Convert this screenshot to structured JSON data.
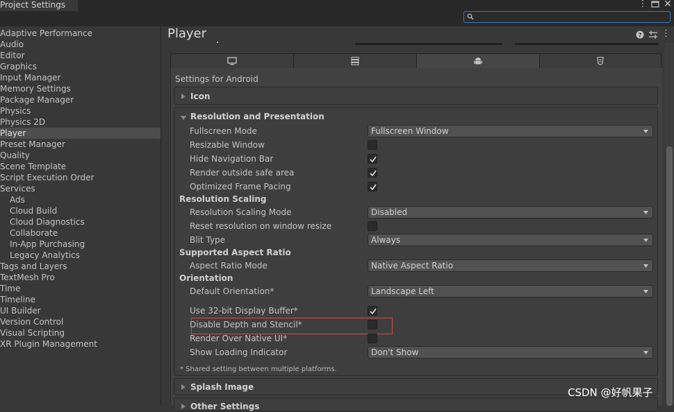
{
  "window": {
    "tab_title": "Project Settings",
    "menu_glyph": "⋮",
    "close_glyph": "✕",
    "more_glyph": "⋮"
  },
  "search": {
    "placeholder": ""
  },
  "sidebar": {
    "items": [
      {
        "label": "Adaptive Performance"
      },
      {
        "label": "Audio"
      },
      {
        "label": "Editor"
      },
      {
        "label": "Graphics"
      },
      {
        "label": "Input Manager"
      },
      {
        "label": "Memory Settings"
      },
      {
        "label": "Package Manager"
      },
      {
        "label": "Physics"
      },
      {
        "label": "Physics 2D"
      },
      {
        "label": "Player",
        "selected": true
      },
      {
        "label": "Preset Manager"
      },
      {
        "label": "Quality"
      },
      {
        "label": "Scene Template"
      },
      {
        "label": "Script Execution Order"
      },
      {
        "label": "Services"
      },
      {
        "label": "Ads",
        "sub": true
      },
      {
        "label": "Cloud Build",
        "sub": true
      },
      {
        "label": "Cloud Diagnostics",
        "sub": true
      },
      {
        "label": "Collaborate",
        "sub": true
      },
      {
        "label": "In-App Purchasing",
        "sub": true
      },
      {
        "label": "Legacy Analytics",
        "sub": true
      },
      {
        "label": "Tags and Layers"
      },
      {
        "label": "TextMesh Pro"
      },
      {
        "label": "Time"
      },
      {
        "label": "Timeline"
      },
      {
        "label": "UI Builder"
      },
      {
        "label": "Version Control"
      },
      {
        "label": "Visual Scripting"
      },
      {
        "label": "XR Plugin Management"
      }
    ]
  },
  "main": {
    "title": "Player",
    "settings_for": "Settings for Android",
    "platform_tabs": [
      {
        "icon": "monitor-icon",
        "active": false
      },
      {
        "icon": "server-icon",
        "active": false
      },
      {
        "icon": "android-icon",
        "active": true
      },
      {
        "icon": "html5-icon",
        "active": false
      }
    ],
    "icon_section": "Icon",
    "resolution_section": "Resolution and Presentation",
    "fullscreen_mode": {
      "label": "Fullscreen Mode",
      "value": "Fullscreen Window"
    },
    "resizable_window": {
      "label": "Resizable Window",
      "checked": false
    },
    "hide_nav_bar": {
      "label": "Hide Navigation Bar",
      "checked": true
    },
    "render_outside_safe": {
      "label": "Render outside safe area",
      "checked": true
    },
    "optimized_frame_pacing": {
      "label": "Optimized Frame Pacing",
      "checked": true
    },
    "resolution_scaling_head": "Resolution Scaling",
    "resolution_scaling_mode": {
      "label": "Resolution Scaling Mode",
      "value": "Disabled"
    },
    "reset_resolution": {
      "label": "Reset resolution on window resize",
      "checked": false
    },
    "blit_type": {
      "label": "Blit Type",
      "value": "Always"
    },
    "aspect_ratio_head": "Supported Aspect Ratio",
    "aspect_ratio_mode": {
      "label": "Aspect Ratio Mode",
      "value": "Native Aspect Ratio"
    },
    "orientation_head": "Orientation",
    "default_orientation": {
      "label": "Default Orientation*",
      "value": "Landscape Left"
    },
    "use_32bit": {
      "label": "Use 32-bit Display Buffer*",
      "checked": true
    },
    "disable_depth": {
      "label": "Disable Depth and Stencil*",
      "checked": false
    },
    "render_over_native": {
      "label": "Render Over Native UI*",
      "checked": false
    },
    "show_loading": {
      "label": "Show Loading Indicator",
      "value": "Don't Show"
    },
    "shared_note": "* Shared setting between multiple platforms.",
    "splash_section": "Splash Image",
    "other_section": "Other Settings"
  },
  "watermark": "CSDN @好帆果子",
  "colors": {
    "highlight": "#e0464a",
    "accent": "#3a79bb"
  }
}
